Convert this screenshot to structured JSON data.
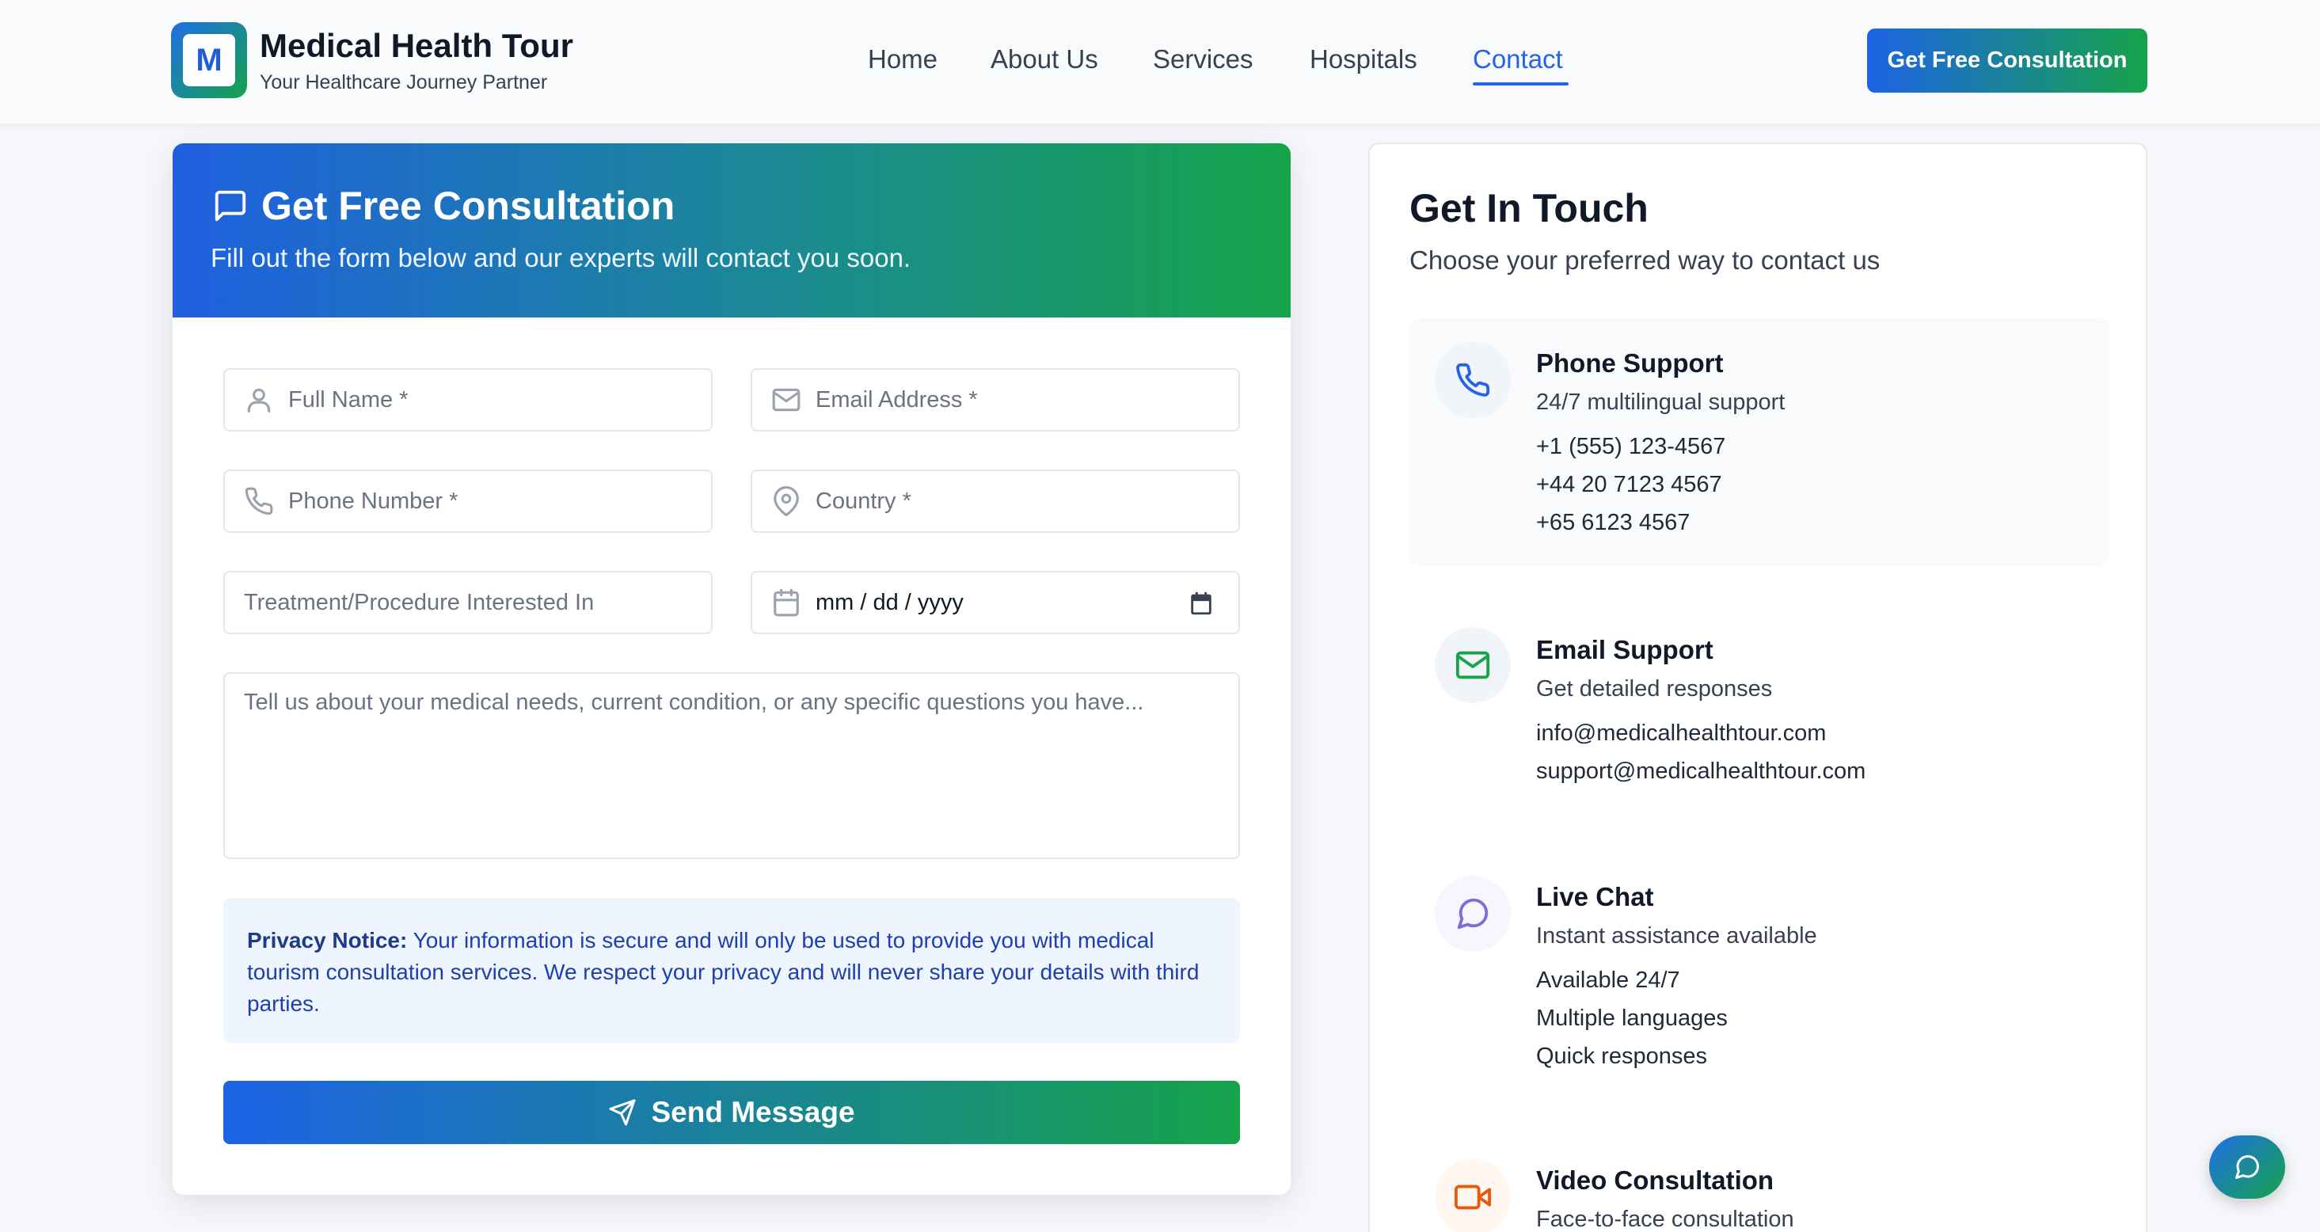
{
  "header": {
    "logo_letter": "M",
    "brand_title": "Medical Health Tour",
    "brand_subtitle": "Your Healthcare Journey Partner",
    "nav": [
      "Home",
      "About Us",
      "Services",
      "Hospitals",
      "Contact"
    ],
    "active_nav": "Contact",
    "cta_label": "Get Free Consultation"
  },
  "form": {
    "title": "Get Free Consultation",
    "subtitle": "Fill out the form below and our experts will contact you soon.",
    "full_name_placeholder": "Full Name *",
    "email_placeholder": "Email Address *",
    "phone_placeholder": "Phone Number *",
    "country_placeholder": "Country *",
    "treatment_placeholder": "Treatment/Procedure Interested In",
    "date_value": "mm / dd / yyyy",
    "message_placeholder": "Tell us about your medical needs, current condition, or any specific questions you have...",
    "privacy_label": "Privacy Notice:",
    "privacy_text": " Your information is secure and will only be used to provide you with medical tourism consultation services. We respect your privacy and will never share your details with third parties.",
    "submit_label": "Send Message"
  },
  "contact": {
    "title": "Get In Touch",
    "subtitle": "Choose your preferred way to contact us",
    "methods": [
      {
        "title": "Phone Support",
        "desc": "24/7 multilingual support",
        "lines": [
          "+1 (555) 123-4567",
          "+44 20 7123 4567",
          "+65 6123 4567"
        ],
        "icon": "phone-icon",
        "color": "#2563eb"
      },
      {
        "title": "Email Support",
        "desc": "Get detailed responses",
        "lines": [
          "info@medicalhealthtour.com",
          "support@medicalhealthtour.com"
        ],
        "icon": "mail-icon",
        "color": "#16a34a"
      },
      {
        "title": "Live Chat",
        "desc": "Instant assistance available",
        "lines": [
          "Available 24/7",
          "Multiple languages",
          "Quick responses"
        ],
        "icon": "chat-icon",
        "color": "#7c6fd6"
      },
      {
        "title": "Video Consultation",
        "desc": "Face-to-face consultation",
        "lines": [],
        "icon": "video-icon",
        "color": "#ea580c"
      }
    ]
  },
  "colors": {
    "primary_blue": "#2563eb",
    "primary_green": "#16a34a"
  }
}
